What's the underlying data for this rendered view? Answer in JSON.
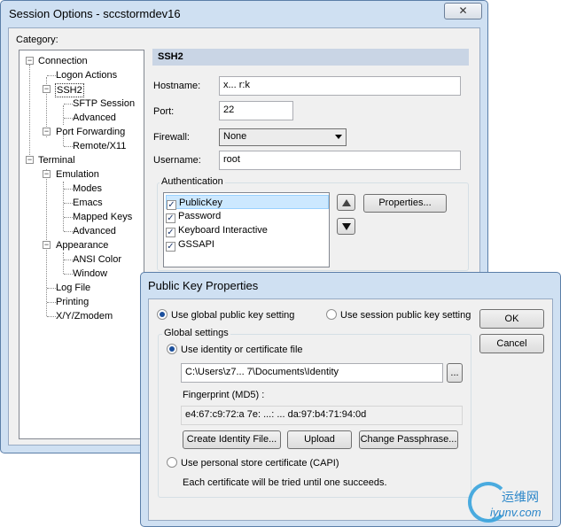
{
  "main_window": {
    "title": "Session Options - sccstormdev16",
    "close_glyph": "✕",
    "category_label": "Category:"
  },
  "tree": {
    "connection": "Connection",
    "logon_actions": "Logon Actions",
    "ssh2": "SSH2",
    "sftp_session": "SFTP Session",
    "advanced_1": "Advanced",
    "port_forwarding": "Port Forwarding",
    "remote_x11": "Remote/X11",
    "terminal": "Terminal",
    "emulation": "Emulation",
    "modes": "Modes",
    "emacs": "Emacs",
    "mapped_keys": "Mapped Keys",
    "advanced_2": "Advanced",
    "appearance": "Appearance",
    "ansi_color": "ANSI Color",
    "window": "Window",
    "log_file": "Log File",
    "printing": "Printing",
    "xyzmodem": "X/Y/Zmodem",
    "expander_minus": "−"
  },
  "ssh2": {
    "section_title": "SSH2",
    "hostname_label": "Hostname:",
    "hostname_value": "x...  r:k",
    "port_label": "Port:",
    "port_value": "22",
    "firewall_label": "Firewall:",
    "firewall_value": "None",
    "username_label": "Username:",
    "username_value": "root",
    "auth_group": "Authentication",
    "auth_methods": [
      "PublicKey",
      "Password",
      "Keyboard Interactive",
      "GSSAPI"
    ],
    "properties_button": "Properties...",
    "check_glyph": "✓"
  },
  "dialog": {
    "title": "Public Key Properties",
    "use_global": "Use global public key setting",
    "use_session": "Use session public key setting",
    "ok_button": "OK",
    "cancel_button": "Cancel",
    "global_settings": "Global settings",
    "use_identity": "Use identity or certificate file",
    "identity_path": "C:\\Users\\z7...  7\\Documents\\Identity",
    "browse_button": "...",
    "fingerprint_label": "Fingerprint (MD5) :",
    "fingerprint_value": "e4:67:c9:72:a  7e:  ...:  ... da:97:b4:71:94:0d",
    "create_identity_button": "Create Identity File...",
    "upload_button": "Upload",
    "change_passphrase_button": "Change Passphrase...",
    "use_capi": "Use personal store certificate (CAPI)",
    "capi_note": "Each certificate will be tried until one succeeds."
  },
  "watermark": {
    "cn": "运维网",
    "url": "iyunv.com"
  },
  "colors": {
    "frame": "#cfe0f2",
    "selection": "#cce8ff",
    "section_header": "#c9d5e5",
    "watermark": "#39a4de"
  }
}
